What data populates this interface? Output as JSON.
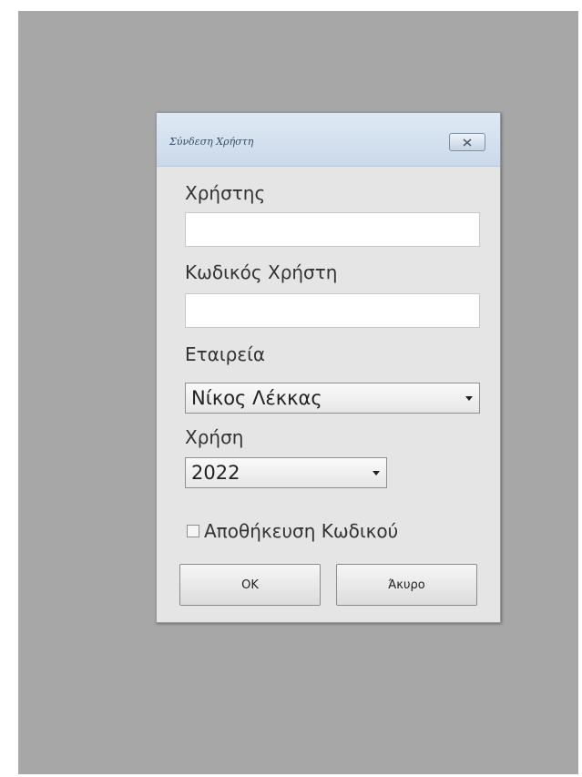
{
  "dialog": {
    "title": "Σύνδεση Χρήστη",
    "close_icon": "close-x-icon"
  },
  "form": {
    "user_label": "Χρήστης",
    "user_value": "",
    "password_label": "Κωδικός Χρήστη",
    "password_value": "",
    "company_label": "Εταιρεία",
    "company_value": "Νίκος Λέκκας",
    "year_label": "Χρήση",
    "year_value": "2022",
    "save_password_label": "Αποθήκευση Κωδικού",
    "save_password_checked": false
  },
  "buttons": {
    "ok_label": "OK",
    "cancel_label": "Άκυρο"
  }
}
